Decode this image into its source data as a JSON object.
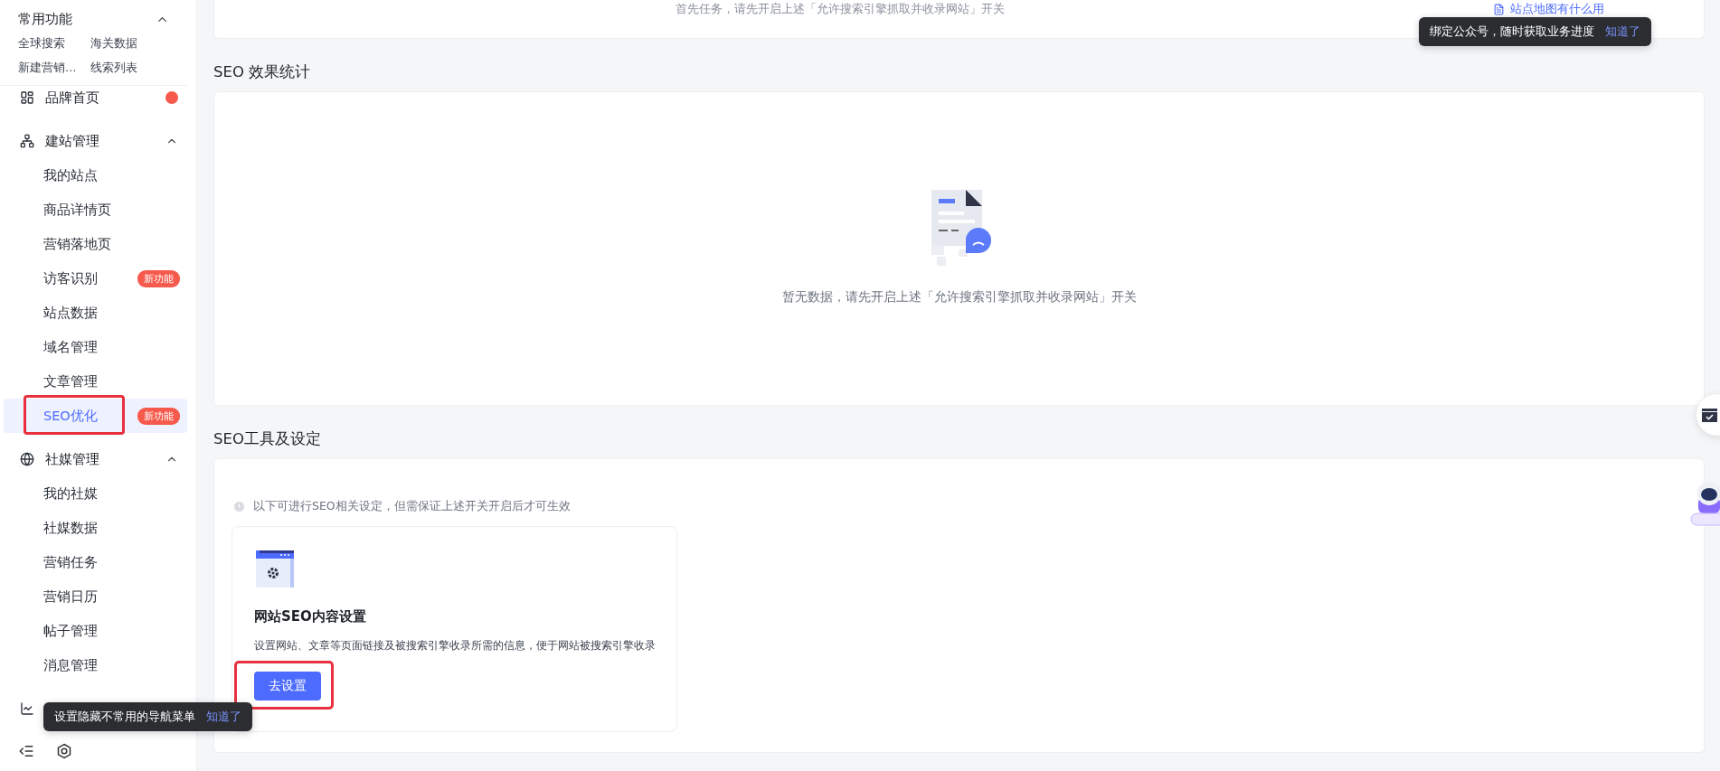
{
  "quick_access": {
    "title": "常用功能",
    "expanded": true,
    "items": [
      "全球搜索",
      "海关数据",
      "新建营销…",
      "线索列表"
    ]
  },
  "nav": [
    {
      "kind": "link",
      "label": "品牌首页",
      "dot": true
    },
    {
      "kind": "group",
      "label": "建站管理",
      "expanded": true,
      "children": [
        {
          "label": "我的站点",
          "selected": false
        },
        {
          "label": "商品详情页",
          "selected": false
        },
        {
          "label": "营销落地页",
          "selected": false
        },
        {
          "label": "访客识别",
          "selected": false,
          "badge": "新功能"
        },
        {
          "label": "站点数据",
          "selected": false
        },
        {
          "label": "域名管理",
          "selected": false
        },
        {
          "label": "文章管理",
          "selected": false
        },
        {
          "label": "SEO优化",
          "selected": true,
          "badge": "新功能",
          "highlighted": true
        }
      ]
    },
    {
      "kind": "group",
      "label": "社媒管理",
      "expanded": true,
      "children": [
        {
          "label": "我的社媒",
          "selected": false
        },
        {
          "label": "社媒数据",
          "selected": false
        },
        {
          "label": "营销任务",
          "selected": false
        },
        {
          "label": "营销日历",
          "selected": false
        },
        {
          "label": "帖子管理",
          "selected": false
        },
        {
          "label": "消息管理",
          "selected": false
        }
      ]
    },
    {
      "kind": "collapsed"
    }
  ],
  "nav_tooltip": {
    "text": "设置隐藏不常用的导航菜单",
    "action": "知道了"
  },
  "top_card": {
    "text": "首先任务，请先开启上述「允许搜索引擎抓取并收录网站」开关",
    "link": "站点地图有什么用"
  },
  "top_tooltip": {
    "text": "绑定公众号，随时获取业务进度",
    "action": "知道了"
  },
  "stats": {
    "title": "SEO 效果统计",
    "empty_message": "暂无数据，请先开启上述「允许搜索引擎抓取并收录网站」开关"
  },
  "tools": {
    "title": "SEO工具及设定",
    "notice": "以下可进行SEO相关设定，但需保证上述开关开启后才可生效",
    "cards": [
      {
        "title": "网站SEO内容设置",
        "description": "设置网站、文章等页面链接及被搜索引擎收录所需的信息，便于网站被搜索引擎收录",
        "button": "去设置",
        "highlighted": true
      }
    ]
  }
}
